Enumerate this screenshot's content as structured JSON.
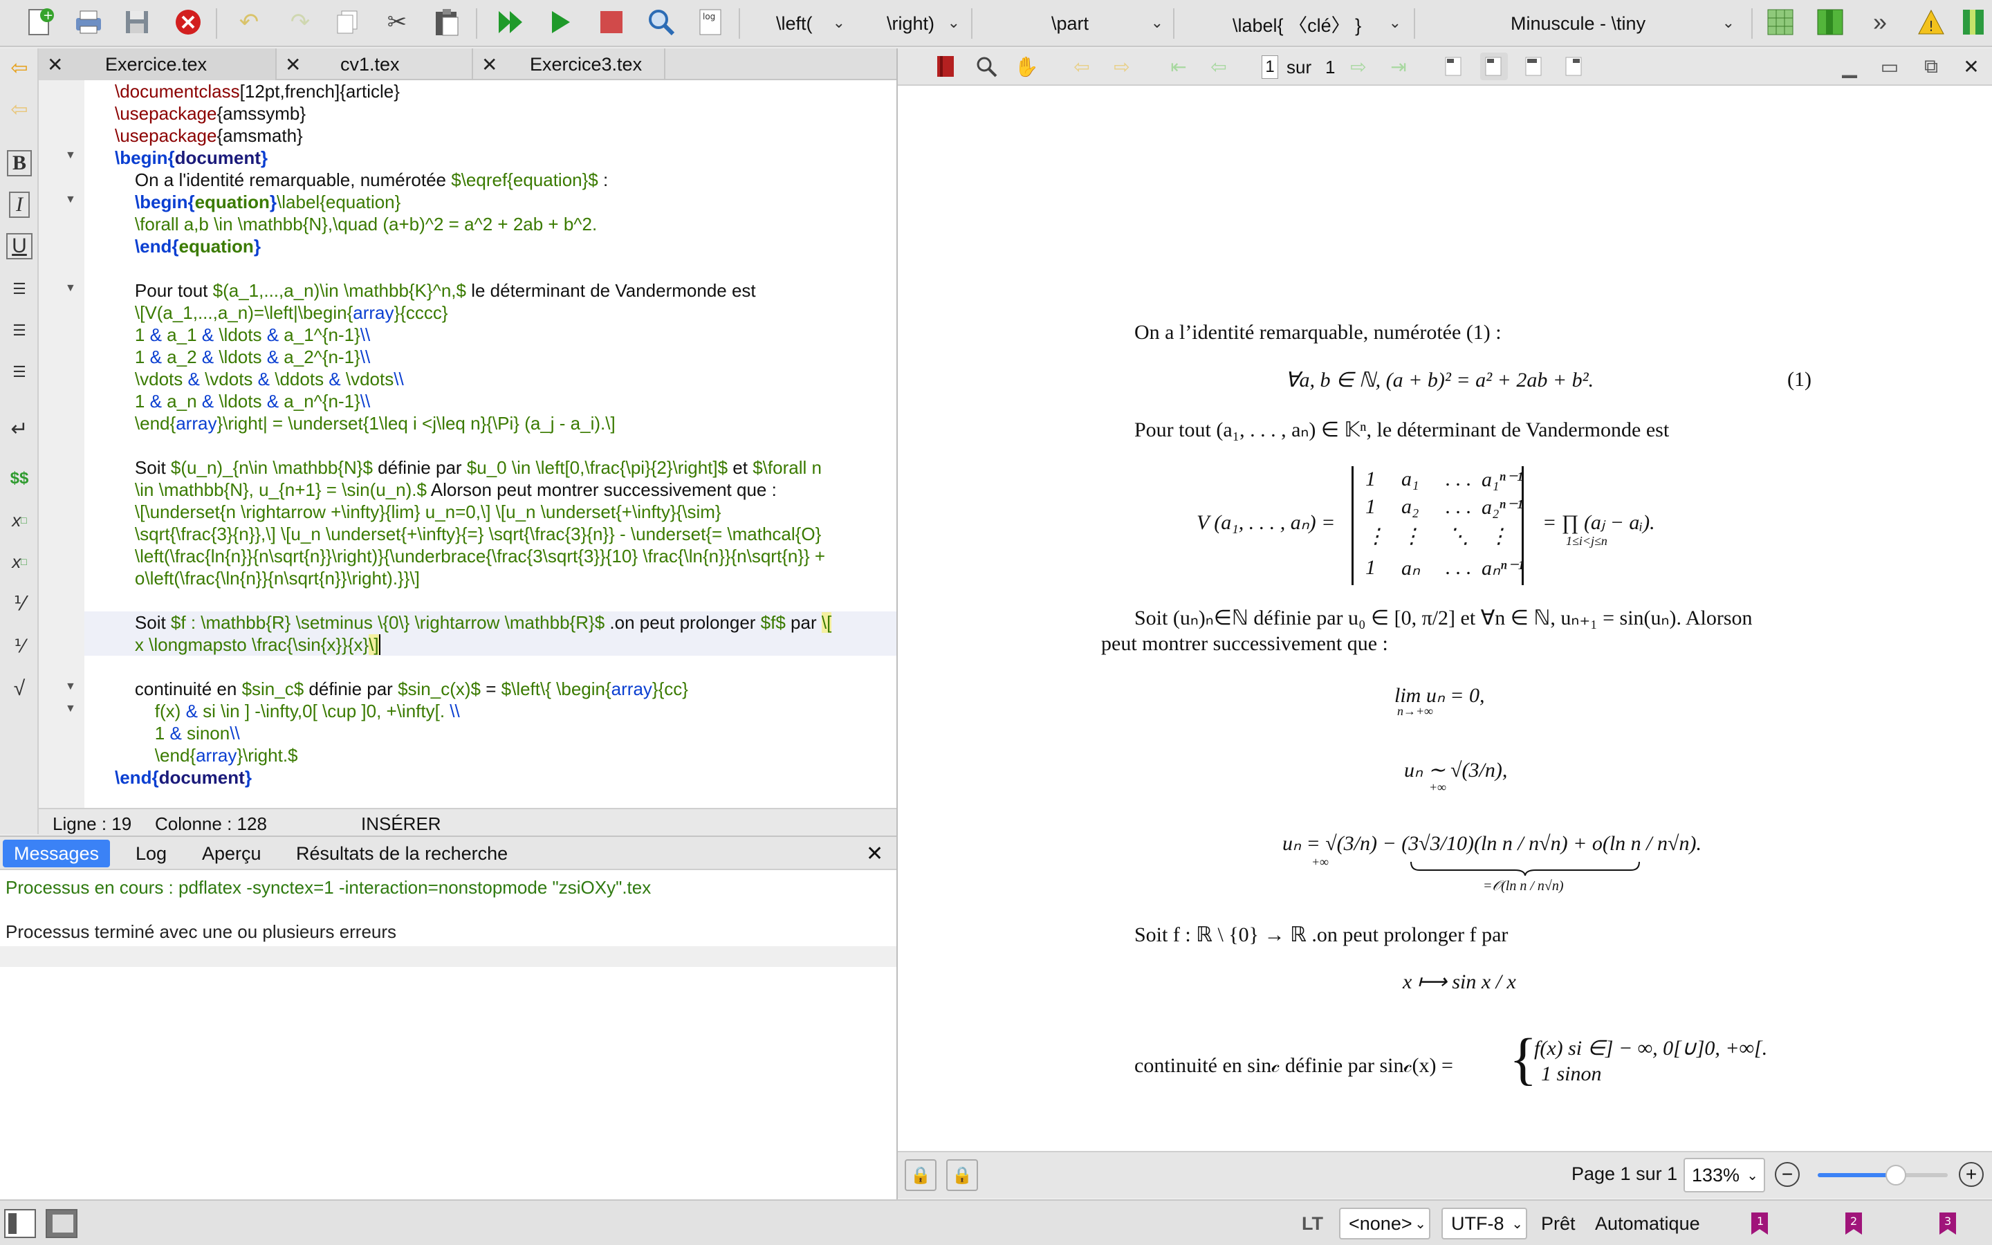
{
  "toolbar": {
    "dd_left": "\\left(",
    "dd_right": "\\right)",
    "dd_part": "\\part",
    "dd_label": "\\label{ 〈clé〉 }",
    "dd_size": "Minuscule - \\tiny",
    "log_label": "log",
    "more": "»"
  },
  "tabs": [
    {
      "label": "Exercice.tex"
    },
    {
      "label": "cv1.tex"
    },
    {
      "label": "Exercice3.tex"
    }
  ],
  "editor": {
    "status_line": "Ligne : 19",
    "status_col": "Colonne : 128",
    "status_mode": "INSÉRER"
  },
  "bottom": {
    "tabs": [
      "Messages",
      "Log",
      "Aperçu",
      "Résultats de la recherche"
    ],
    "line1": "Processus en cours : pdflatex -synctex=1 -interaction=nonstopmode \"zsiOXy\".tex",
    "line2": "Processus terminé avec une ou plusieurs erreurs"
  },
  "viewer": {
    "page_current": "1",
    "page_of": "sur",
    "page_total": "1",
    "page_status": "Page 1 sur 1",
    "zoom": "133%",
    "zoom_level": 0.6
  },
  "doc": {
    "p1": "On a l’identité remarquable, numérotée (1) :",
    "eq1": "∀a, b ∈ ℕ,    (a + b)² = a² + 2ab + b².",
    "eq1_num": "(1)",
    "p2": "Pour tout (a₁, . . . , aₙ) ∈ 𝕂ⁿ, le déterminant de Vandermonde est",
    "vdm_left": "V (a₁, . . . , aₙ) =",
    "vdm_right": "= ∏ (aⱼ − aᵢ).",
    "vdm_sub": "1≤i<j≤n",
    "vdm_rows": [
      [
        "1",
        "a₁",
        ". . .",
        "a₁ⁿ⁻¹"
      ],
      [
        "1",
        "a₂",
        ". . .",
        "a₂ⁿ⁻¹"
      ],
      [
        "⋮",
        "⋮",
        "⋱",
        "⋮"
      ],
      [
        "1",
        "aₙ",
        ". . .",
        "aₙⁿ⁻¹"
      ]
    ],
    "p3a": "Soit (uₙ)ₙ∈ℕ définie par u₀ ∈ [0, π/2] et ∀n ∈ ℕ, uₙ₊₁ = sin(uₙ). Alorson",
    "p3b": "peut montrer successivement que :",
    "lim": "lim uₙ = 0,",
    "lim_sub": "n→+∞",
    "equiv": "uₙ ∼ √(3/n),",
    "equiv_sub": "+∞",
    "dev": "uₙ = √(3/n) − (3√3/10)(ln n / n√n) + o(ln n / n√n).",
    "dev_sub": "+∞",
    "brace_label": "=𝒪(ln n / n√n)",
    "p4": "Soit f : ℝ \\ {0} → ℝ .on peut prolonger f par",
    "map": "x ⟼ sin x / x",
    "p5": "continuité en sin𝒸 définie par sin𝒸(x) =",
    "case1": "f(x)     si ∈] − ∞, 0[∪]0, +∞[.",
    "case2": "1              sinon"
  },
  "statusbar": {
    "lt": "LT",
    "none": "<none>",
    "enc": "UTF-8",
    "ready": "Prêt",
    "auto": "Automatique"
  }
}
